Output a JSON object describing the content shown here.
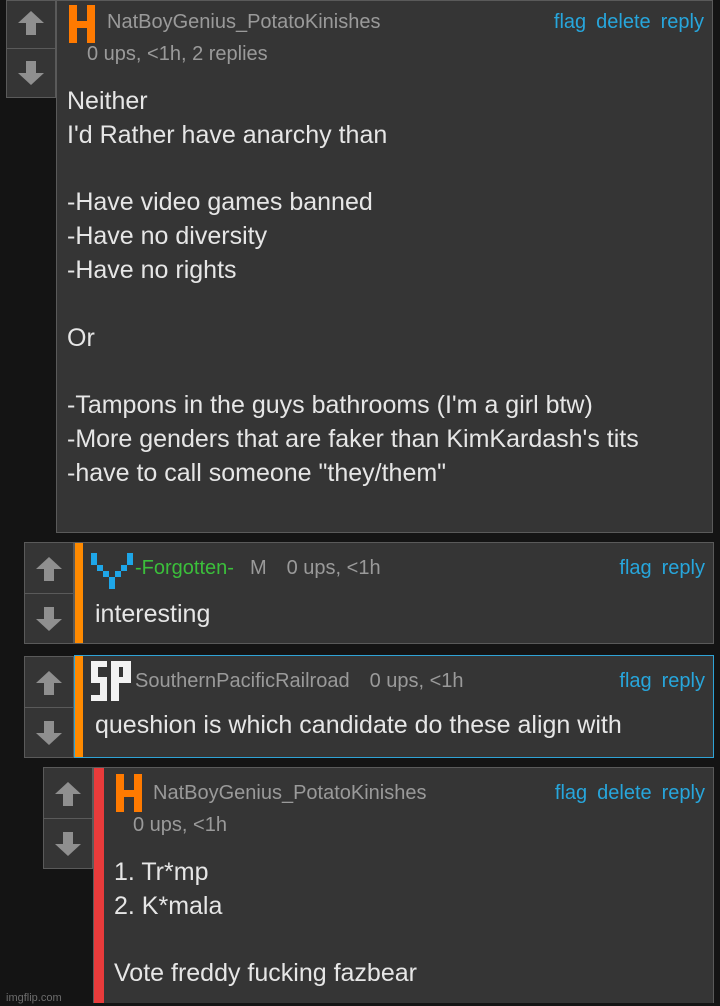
{
  "colors": {
    "background": "#141414",
    "panel": "#353535",
    "border": "#5a5a5a",
    "link": "#27a6dc",
    "muted": "#9a9a9a",
    "orange_stripe": "#ff8a00",
    "red_stripe": "#e83b3b",
    "green_user": "#3bbf3b",
    "highlight_border": "#2fa3d6"
  },
  "comments": [
    {
      "username": "NatBoyGenius_PotatoKinishes",
      "meta": "0 ups, <1h, 2 replies",
      "actions": [
        "flag",
        "delete",
        "reply"
      ],
      "avatar_icon": "orange-h-avatar-icon",
      "body": "Neither\nI'd Rather have anarchy than\n\n-Have video games banned\n-Have no diversity\n-Have no rights\n\nOr\n\n-Tampons in the guys bathrooms (I'm a girl btw)\n-More genders that are faker than KimKardash's tits\n-have to call someone \"they/them\""
    },
    {
      "username": "-Forgotten-",
      "badge": "M",
      "meta": "0 ups, <1h",
      "actions": [
        "flag",
        "reply"
      ],
      "avatar_icon": "blue-heart-avatar-icon",
      "body": "interesting"
    },
    {
      "username": "SouthernPacificRailroad",
      "meta": "0 ups, <1h",
      "actions": [
        "flag",
        "reply"
      ],
      "avatar_icon": "sp-logo-avatar-icon",
      "body": "queshion is which candidate do these align with"
    },
    {
      "username": "NatBoyGenius_PotatoKinishes",
      "meta": "0 ups, <1h",
      "actions": [
        "flag",
        "delete",
        "reply"
      ],
      "avatar_icon": "orange-h-avatar-icon",
      "body": "1. Tr*mp\n2. K*mala\n\nVote freddy fucking fazbear"
    }
  ],
  "vote": {
    "up_icon": "upvote-arrow-icon",
    "down_icon": "downvote-arrow-icon"
  },
  "watermark": "imgflip.com"
}
